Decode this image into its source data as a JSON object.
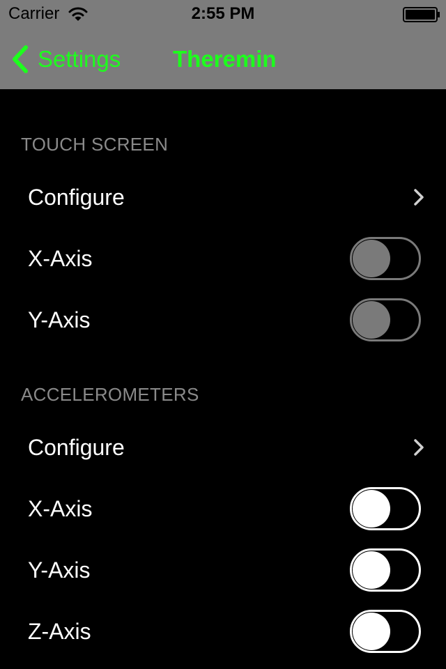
{
  "status_bar": {
    "carrier": "Carrier",
    "time": "2:55 PM"
  },
  "nav": {
    "back_label": "Settings",
    "title": "Theremin"
  },
  "colors": {
    "accent": "#1dff1d",
    "nav_background": "#7c7c7c",
    "background": "#000000",
    "section_header": "#8a8a8a"
  },
  "sections": [
    {
      "header": "TOUCH SCREEN",
      "rows": [
        {
          "label": "Configure",
          "type": "disclosure"
        },
        {
          "label": "X-Axis",
          "type": "switch",
          "on": false,
          "enabled": false
        },
        {
          "label": "Y-Axis",
          "type": "switch",
          "on": false,
          "enabled": false
        }
      ]
    },
    {
      "header": "ACCELEROMETERS",
      "rows": [
        {
          "label": "Configure",
          "type": "disclosure"
        },
        {
          "label": "X-Axis",
          "type": "switch",
          "on": false,
          "enabled": true
        },
        {
          "label": "Y-Axis",
          "type": "switch",
          "on": false,
          "enabled": true
        },
        {
          "label": "Z-Axis",
          "type": "switch",
          "on": false,
          "enabled": true
        }
      ]
    }
  ]
}
